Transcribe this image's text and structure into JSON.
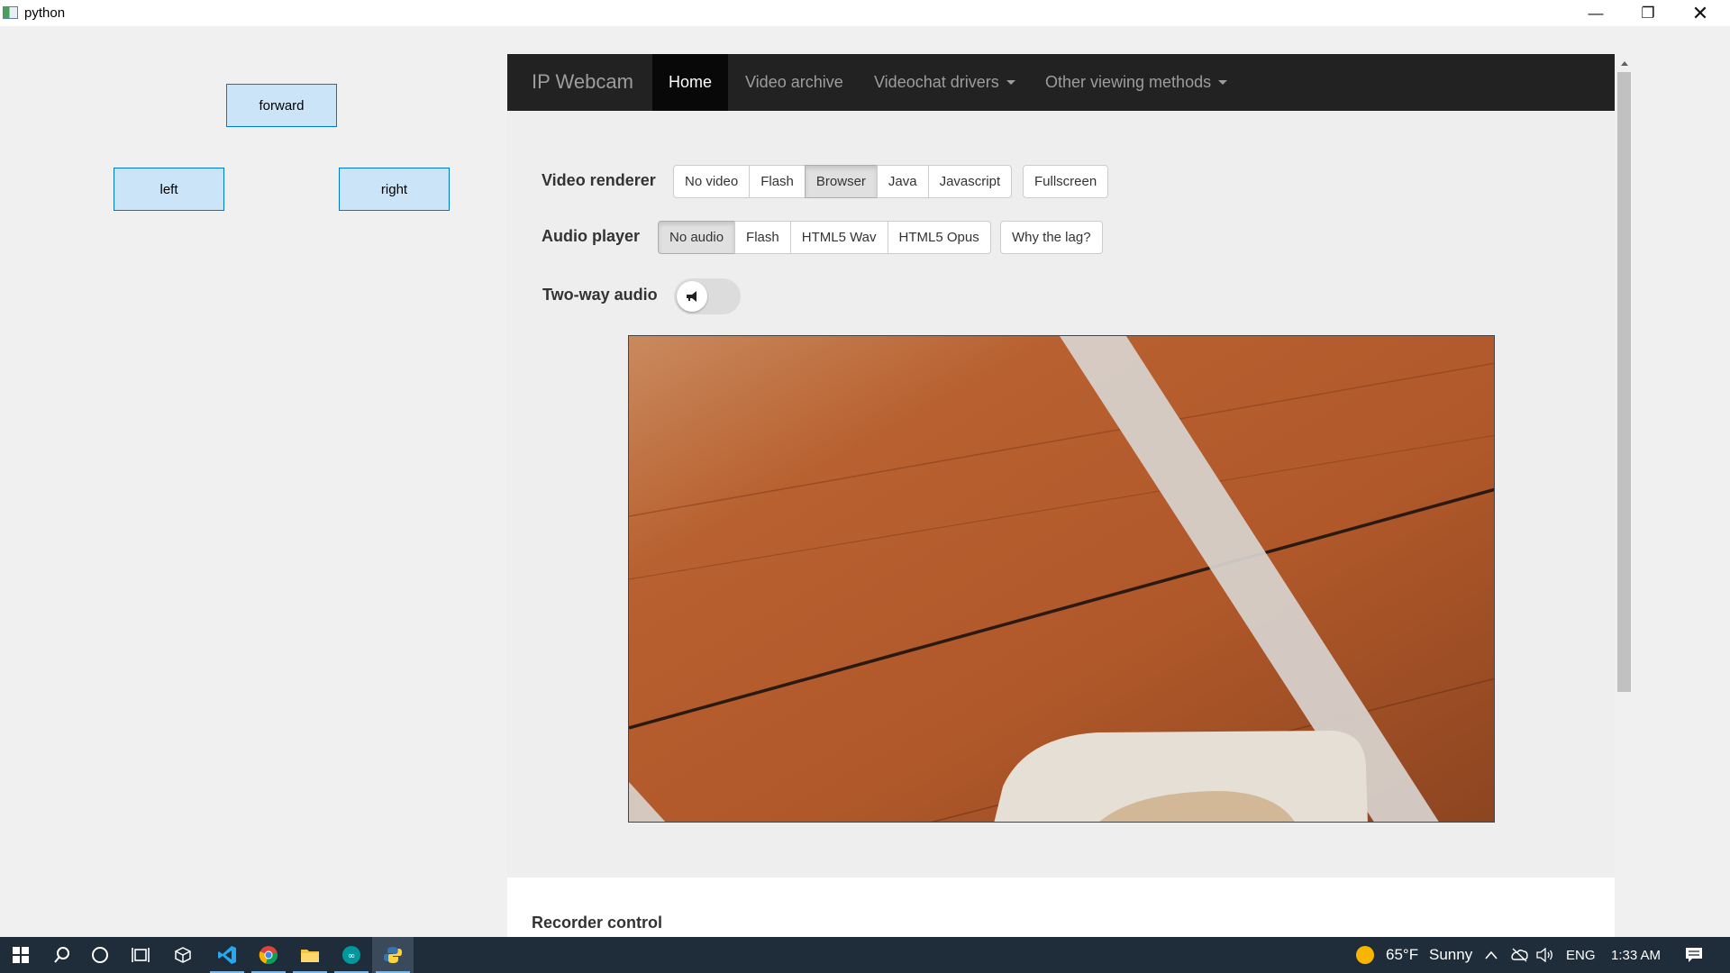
{
  "window": {
    "title": "python",
    "minimize": "—",
    "maximize": "❐",
    "close": "✕"
  },
  "controls": {
    "forward": "forward",
    "left": "left",
    "right": "right"
  },
  "navbar": {
    "brand": "IP Webcam",
    "items": [
      "Home",
      "Video archive",
      "Videochat drivers",
      "Other viewing methods"
    ],
    "active": "Home"
  },
  "video_renderer": {
    "label": "Video renderer",
    "options": [
      "No video",
      "Flash",
      "Browser",
      "Java",
      "Javascript"
    ],
    "selected": "Browser",
    "fullscreen": "Fullscreen"
  },
  "audio_player": {
    "label": "Audio player",
    "options": [
      "No audio",
      "Flash",
      "HTML5 Wav",
      "HTML5 Opus"
    ],
    "selected": "No audio",
    "lag_help": "Why the lag?"
  },
  "two_way_audio": {
    "label": "Two-way audio",
    "enabled": false
  },
  "recorder": {
    "title": "Recorder control"
  },
  "taskbar": {
    "weather_temp": "65°F",
    "weather_desc": "Sunny",
    "language": "ENG",
    "time": "1:33 AM"
  }
}
